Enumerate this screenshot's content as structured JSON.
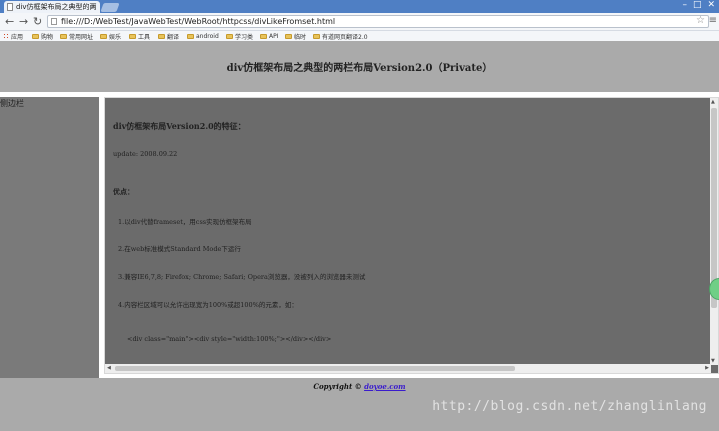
{
  "browser": {
    "tab_title": "div仿框架布局之典型的两",
    "url": "file:///D:/WebTest/JavaWebTest/WebRoot/httpcss/divLikeFromset.html",
    "bookmarks": [
      "应用",
      "购物",
      "常用网址",
      "娱乐",
      "工具",
      "翻译",
      "android",
      "学习类",
      "API",
      "临时",
      "有道网页翻译2.0"
    ]
  },
  "page": {
    "header_title": "div仿框架布局之典型的两栏布局Version2.0（Private）",
    "sidebar_label": "侧边栏",
    "content": {
      "title": "div仿框架布局Version2.0的特征：",
      "update": "update: 2008.09.22",
      "pros_label": "优点：",
      "items": [
        "1.以div代替frameset，用css实现仿框架布局",
        "2.在web标准模式Standard Mode下运行",
        "3.兼容IE6,7,8; Firefox; Chrome; Safari; Opera浏览器，没被列入的浏览器未测试",
        "4.内容栏区域可以允许出现宽为100%或超100%的元素，如："
      ],
      "code": "<div class=\"main\"><div style=\"width:100%;\"></div></div>"
    },
    "footer": {
      "copyright": "Copyright ©",
      "link": "doyoe.com"
    },
    "watermark": "http://blog.csdn.net/zhanglinlang"
  }
}
